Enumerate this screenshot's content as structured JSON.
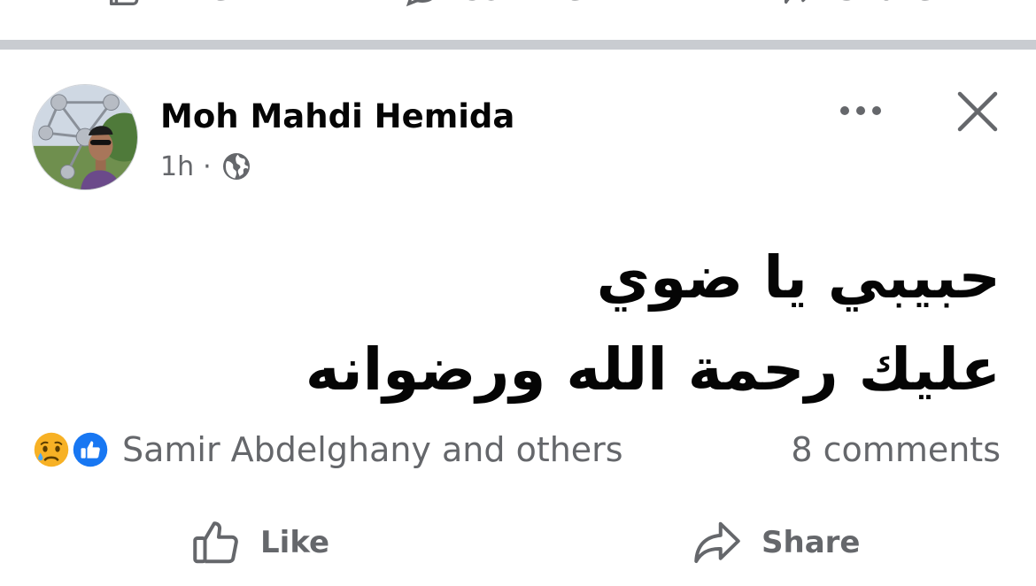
{
  "previous_post": {
    "actions": [
      {
        "label": "Like",
        "icon": "like-icon"
      },
      {
        "label": "Comment",
        "icon": "comment-icon"
      },
      {
        "label": "Share",
        "icon": "share-icon"
      }
    ]
  },
  "post": {
    "author": "Moh Mahdi Hemida",
    "time": "1h",
    "separator": "·",
    "audience_icon": "globe-icon",
    "text_lines": [
      "حبيبي يا ضوي",
      "عليك رحمة الله ورضوانه"
    ],
    "reactions": {
      "icons": [
        "sad-reaction-icon",
        "like-reaction-icon"
      ],
      "summary": "Samir Abdelghany and others"
    },
    "comments_count": "8 comments",
    "actions": {
      "like_label": "Like",
      "share_label": "Share"
    }
  },
  "colors": {
    "secondary_text": "#65676b",
    "primary_text": "#050505",
    "like_blue": "#1877f2",
    "sad_yellow": "#f7b125",
    "divider": "#c9ccd1"
  }
}
